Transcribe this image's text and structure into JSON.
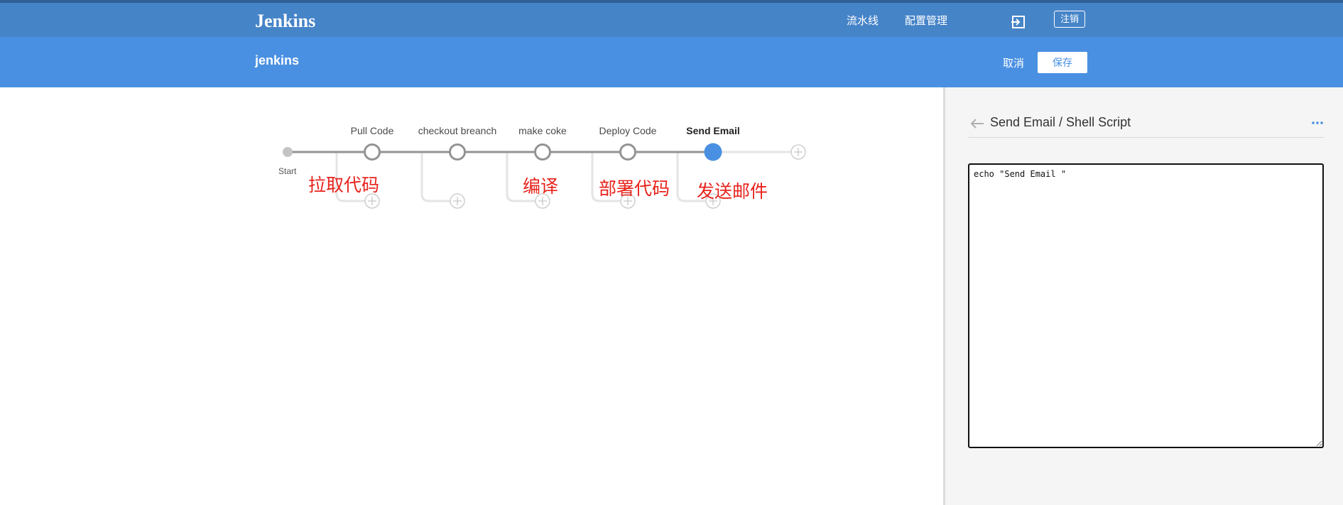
{
  "header": {
    "logo": "Jenkins",
    "nav": [
      "流水线",
      "配置管理"
    ],
    "logout_label": "注销"
  },
  "subheader": {
    "title": "jenkins",
    "cancel_label": "取消",
    "save_label": "保存"
  },
  "pipeline": {
    "start_label": "Start",
    "stages": [
      {
        "name": "Pull Code",
        "annotation": "拉取代码"
      },
      {
        "name": "checkout breanch",
        "annotation": ""
      },
      {
        "name": "make coke",
        "annotation": "编译"
      },
      {
        "name": "Deploy Code",
        "annotation": "部署代码"
      },
      {
        "name": "Send Email",
        "annotation": "发送邮件",
        "selected": true
      }
    ]
  },
  "panel": {
    "title": "Send Email / Shell Script",
    "script": "echo \"Send Email \""
  },
  "colors": {
    "topbar": "#4684c8",
    "subbar": "#4a90e2",
    "selected_node": "#4a90e2",
    "annotation": "#e8231c"
  }
}
